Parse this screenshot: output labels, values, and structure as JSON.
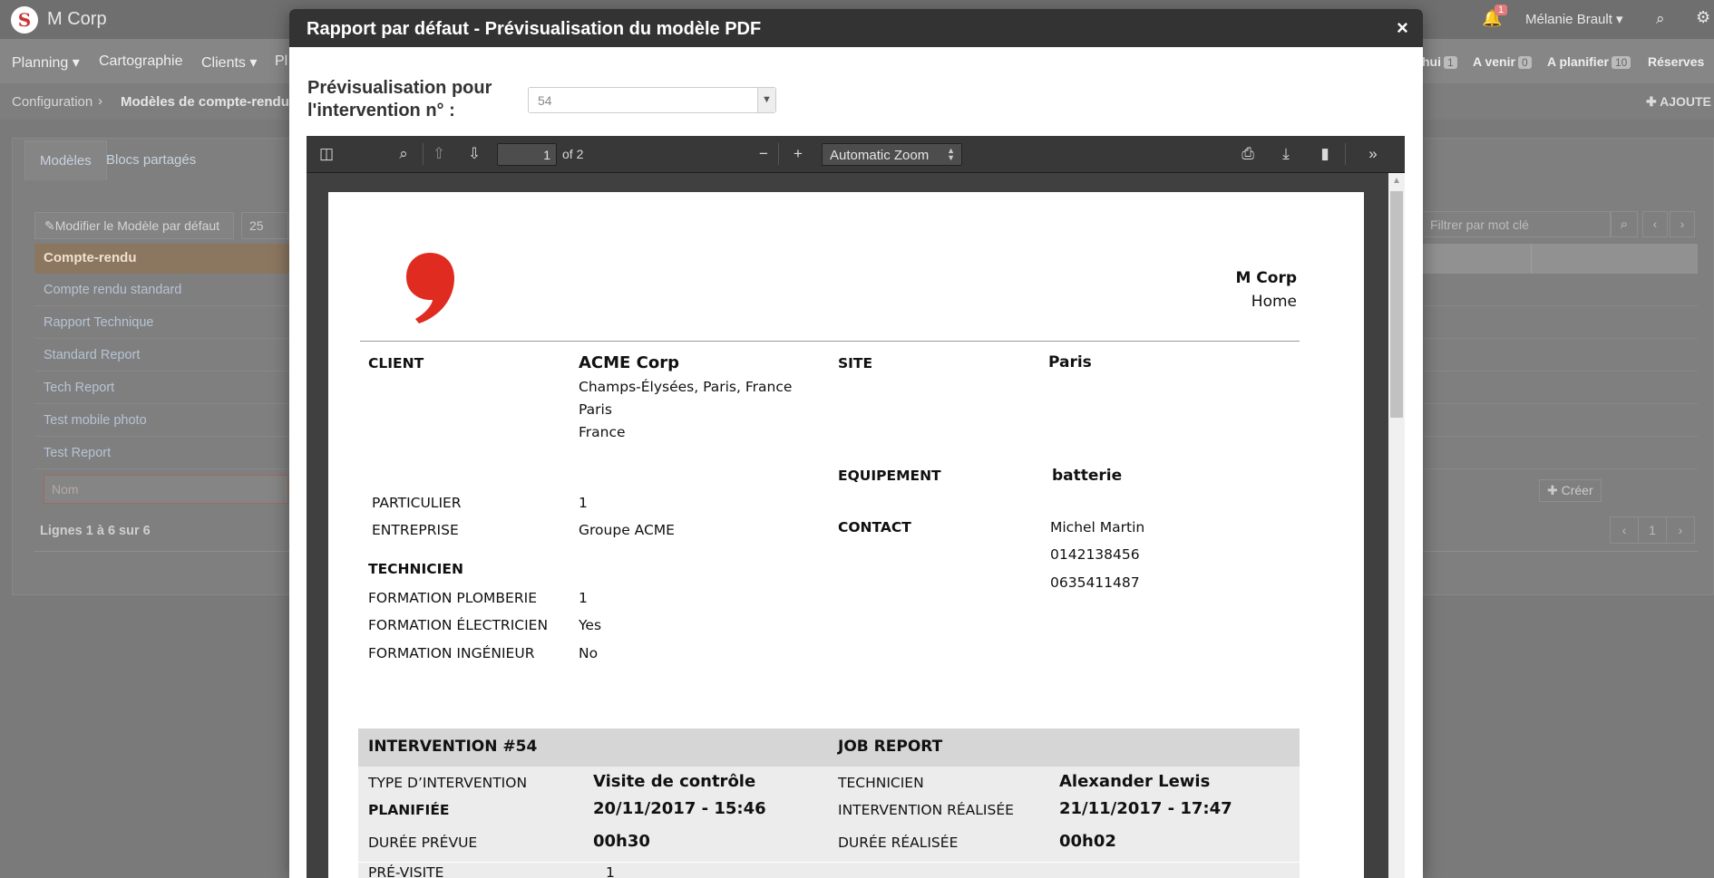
{
  "app": {
    "brand": "M Corp",
    "notification_count": "1",
    "user_name": "Mélanie Brault ▾"
  },
  "nav": {
    "items": [
      "Planning ▾",
      "Cartographie",
      "Clients ▾",
      "Pl"
    ],
    "right": [
      {
        "label": "hui",
        "count": "1"
      },
      {
        "label": "A venir",
        "count": "0"
      },
      {
        "label": "A planifier",
        "count": "10"
      },
      {
        "label": "Réserves",
        "count": ""
      }
    ]
  },
  "breadcrumb": {
    "root": "Configuration",
    "current": "Modèles de compte-rendu",
    "add_label": "✚ AJOUTE"
  },
  "background": {
    "tabs": [
      "Modèles",
      "Blocs partagés"
    ],
    "edit_button": "Modifier le Modèle par défaut",
    "page_size": "25",
    "filter_placeholder": "Filtrer par mot clé",
    "table_header": "Compte-rendu",
    "rows": [
      "Compte rendu standard",
      "Rapport Technique",
      "Standard Report",
      "Tech Report",
      "Test mobile photo",
      "Test Report"
    ],
    "name_placeholder": "Nom",
    "create_label": "✚ Créer",
    "lines_info": "Lignes 1 à 6 sur 6",
    "pager_page": "1"
  },
  "modal": {
    "title": "Rapport par défaut - Prévisualisation du modèle PDF",
    "close": "×",
    "preview_label": "Prévisualisation pour l'intervention n° :",
    "selected_intervention": "54"
  },
  "viewer": {
    "page_number": "1",
    "page_of": "of 2",
    "zoom": "Automatic Zoom"
  },
  "report": {
    "company_name": "M Corp",
    "company_sub": "Home",
    "client_label": "CLIENT",
    "client_name": "ACME Corp",
    "client_address": "Champs-Élysées, Paris, France",
    "client_city": "Paris",
    "client_country": "France",
    "site_label": "SITE",
    "site_value": "Paris",
    "equipment_label": "EQUIPEMENT",
    "equipment_value": "batterie",
    "particulier_label": "PARTICULIER",
    "particulier_value": "1",
    "entreprise_label": "ENTREPRISE",
    "entreprise_value": "Groupe ACME",
    "contact_label": "CONTACT",
    "contact_name": "Michel Martin",
    "contact_phone1": "0142138456",
    "contact_phone2": "0635411487",
    "technicien_label": "TECHNICIEN",
    "plomberie_label": "FORMATION PLOMBERIE",
    "plomberie_value": "1",
    "electricien_label": "FORMATION ÉLECTRICIEN",
    "electricien_value": "Yes",
    "ingenieur_label": "FORMATION INGÉNIEUR",
    "ingenieur_value": "No",
    "intervention_heading": "INTERVENTION  #54",
    "job_report_heading": "JOB REPORT",
    "type_label": "TYPE D’INTERVENTION",
    "type_value": "Visite de contrôle",
    "planifiee_label": "PLANIFIÉE",
    "planifiee_value": "20/11/2017 - 15:46",
    "duree_prevue_label": "DURÉE PRÉVUE",
    "duree_prevue_value": "00h30",
    "previsite_label": "PRÉ-VISITE",
    "previsite_value": "1",
    "tech_label": "TECHNICIEN",
    "tech_value": "Alexander Lewis",
    "realisee_label": "INTERVENTION RÉALISÉE",
    "realisee_value": "21/11/2017 - 17:47",
    "duree_realisee_label": "DURÉE RÉALISÉE",
    "duree_realisee_value": "00h02"
  },
  "colors": {
    "modal_header": "#333333",
    "logo_red": "#e02b20",
    "band_head": "#d6d6d6",
    "band_body": "#ececec"
  },
  "icons": [
    "sidebar-toggle-icon",
    "find-icon",
    "previous-page-icon",
    "next-page-icon",
    "zoom-out-icon",
    "zoom-in-icon",
    "print-icon",
    "download-icon",
    "bookmark-icon",
    "tools-icon",
    "bell-icon",
    "search-icon",
    "gear-icon"
  ]
}
